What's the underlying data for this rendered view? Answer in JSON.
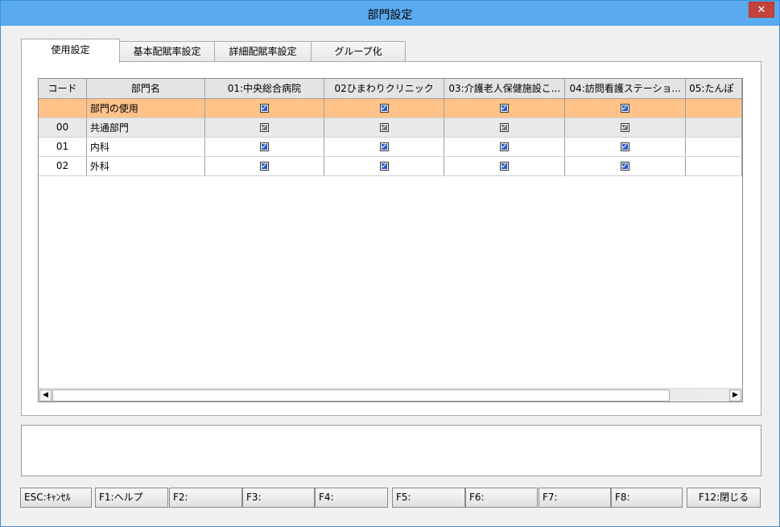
{
  "window": {
    "title": "部門設定",
    "close_glyph": "✕"
  },
  "tabs": [
    {
      "label": "使用設定",
      "active": true
    },
    {
      "label": "基本配賦率設定",
      "active": false
    },
    {
      "label": "詳細配賦率設定",
      "active": false
    },
    {
      "label": "グループ化",
      "active": false
    }
  ],
  "grid": {
    "columns": [
      "コード",
      "部門名",
      "01:中央総合病院",
      "02ひまわりクリニック",
      "03:介護老人保健施設こ...",
      "04:訪問看護ステーショ...",
      "05:たんぽ"
    ],
    "rows": [
      {
        "code": "",
        "name": "部門の使用",
        "checks": [
          true,
          true,
          true,
          true
        ],
        "style": "usage"
      },
      {
        "code": "00",
        "name": "共通部門",
        "checks": [
          true,
          true,
          true,
          true
        ],
        "style": "common"
      },
      {
        "code": "01",
        "name": "内科",
        "checks": [
          true,
          true,
          true,
          true
        ],
        "style": "normal"
      },
      {
        "code": "02",
        "name": "外科",
        "checks": [
          true,
          true,
          true,
          true
        ],
        "style": "normal"
      }
    ],
    "checkbox_color": "#2a5ad8",
    "usage_row_color": "#ffc38a"
  },
  "scrollbar": {
    "left_arrow": "◀",
    "right_arrow": "▶"
  },
  "message": "",
  "fkeys": [
    {
      "label": "ESC:ｷｬﾝｾﾙ"
    },
    {
      "label": "F1:ヘルプ"
    },
    {
      "label": "F2:"
    },
    {
      "label": "F3:"
    },
    {
      "label": "F4:"
    },
    {
      "label": "F5:"
    },
    {
      "label": "F6:"
    },
    {
      "label": "F7:"
    },
    {
      "label": "F8:"
    },
    {
      "label": "F12:閉じる"
    }
  ]
}
